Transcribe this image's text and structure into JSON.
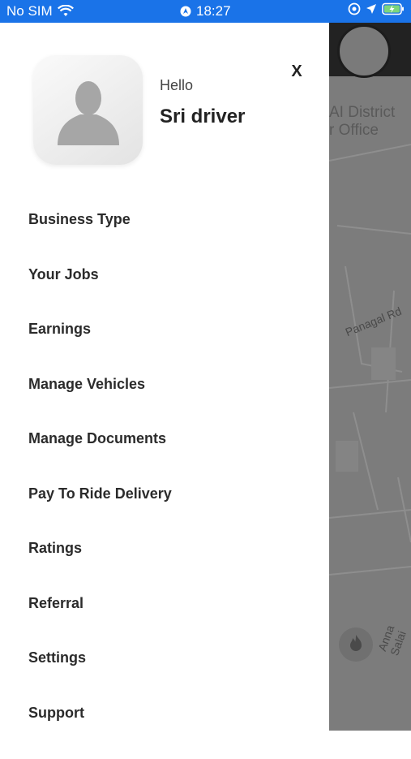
{
  "status_bar": {
    "carrier": "No SIM",
    "time": "18:27"
  },
  "drawer": {
    "greeting": "Hello",
    "user_name": "Sri driver",
    "close_label": "X",
    "menu": [
      {
        "label": "Business Type"
      },
      {
        "label": "Your Jobs"
      },
      {
        "label": "Earnings"
      },
      {
        "label": "Manage Vehicles"
      },
      {
        "label": "Manage Documents"
      },
      {
        "label": "Pay To Ride Delivery"
      },
      {
        "label": "Ratings"
      },
      {
        "label": "Referral"
      },
      {
        "label": "Settings"
      },
      {
        "label": "Support"
      }
    ]
  },
  "map": {
    "place_line1": "AI District",
    "place_line2": "r Office",
    "road1": "Panagal Rd",
    "road2": "Anna Salai"
  },
  "colors": {
    "status_bar": "#1a73e8",
    "map_overlay": "#7c7c7c",
    "text_dark": "#2b2b2b"
  },
  "icons": [
    "wifi-icon",
    "location-icon",
    "clock-lock-icon",
    "navigation-arrow-icon",
    "battery-icon",
    "avatar-placeholder-icon",
    "flame-icon"
  ]
}
